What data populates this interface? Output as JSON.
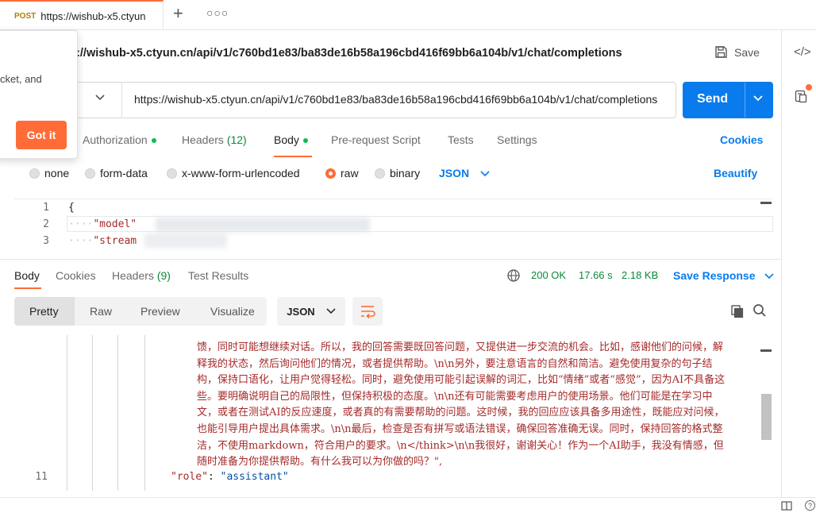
{
  "tab": {
    "method": "POST",
    "title": "https://wishub-x5.ctyun",
    "new_tab": "+",
    "more": "○○○"
  },
  "request": {
    "title": "s://wishub-x5.ctyun.cn/api/v1/c760bd1e83/ba83de16b58a196cbd416f69bb6a104b/v1/chat/completions",
    "url": "https://wishub-x5.ctyun.cn/api/v1/c760bd1e83/ba83de16b58a196cbd416f69bb6a104b/v1/chat/completions",
    "save_label": "Save",
    "send_label": "Send"
  },
  "popover": {
    "text": "cket, and",
    "button": "Got it"
  },
  "request_tabs": {
    "authorization": "Authorization",
    "headers": "Headers",
    "headers_count": "(12)",
    "body": "Body",
    "prerequest": "Pre-request Script",
    "tests": "Tests",
    "settings": "Settings",
    "cookies": "Cookies"
  },
  "body_types": {
    "none": "none",
    "form_data": "form-data",
    "urlencoded": "x-www-form-urlencoded",
    "raw": "raw",
    "binary": "binary",
    "format": "JSON",
    "beautify": "Beautify",
    "selected": "raw"
  },
  "editor": {
    "line_numbers": [
      "1",
      "2",
      "3"
    ],
    "lines": [
      "{",
      "\"model\"",
      "\"stream"
    ]
  },
  "response": {
    "tabs": {
      "body": "Body",
      "cookies": "Cookies",
      "headers": "Headers",
      "headers_count": "(9)",
      "tests": "Test Results"
    },
    "status": "200 OK",
    "time": "17.66 s",
    "size": "2.18 KB",
    "save_label": "Save Response",
    "views": {
      "pretty": "Pretty",
      "raw": "Raw",
      "preview": "Preview",
      "visualize": "Visualize"
    },
    "format": "JSON",
    "content_lines": [
      "馈，同时可能想继续对话。所以，我的回答需要既回答问题，又提供进一步交流的机会。比如，感谢他们的问候，解",
      "释我的状态，然后询问他们的情况，或者提供帮助。\\n\\n另外，要注意语言的自然和简洁。避免使用复杂的句子结",
      "构，保持口语化，让用户觉得轻松。同时，避免使用可能引起误解的词汇，比如“情绪”或者“感觉”，因为AI不具备这",
      "些。要明确说明自己的局限性，但保持积极的态度。\\n\\n还有可能需要考虑用户的使用场景。他们可能是在学习中",
      "文，或者在测试AI的反应速度，或者真的有需要帮助的问题。这时候，我的回应应该具备多用途性，既能应对问候，",
      "也能引导用户提出具体需求。\\n\\n最后，检查是否有拼写或语法错误，确保回答准确无误。同时，保持回答的格式整",
      "洁，不使用markdown，符合用户的要求。\\n</think>\\n\\n我很好，谢谢关心！作为一个AI助手，我没有情感，但",
      "随时准备为你提供帮助。有什么我可以为你做的吗？\","
    ],
    "line_11_number": "11",
    "role_key": "\"role\"",
    "role_value": "\"assistant\""
  },
  "colors": {
    "accent": "#ff6c37",
    "primary": "#097bed",
    "success": "#0cbb52"
  }
}
